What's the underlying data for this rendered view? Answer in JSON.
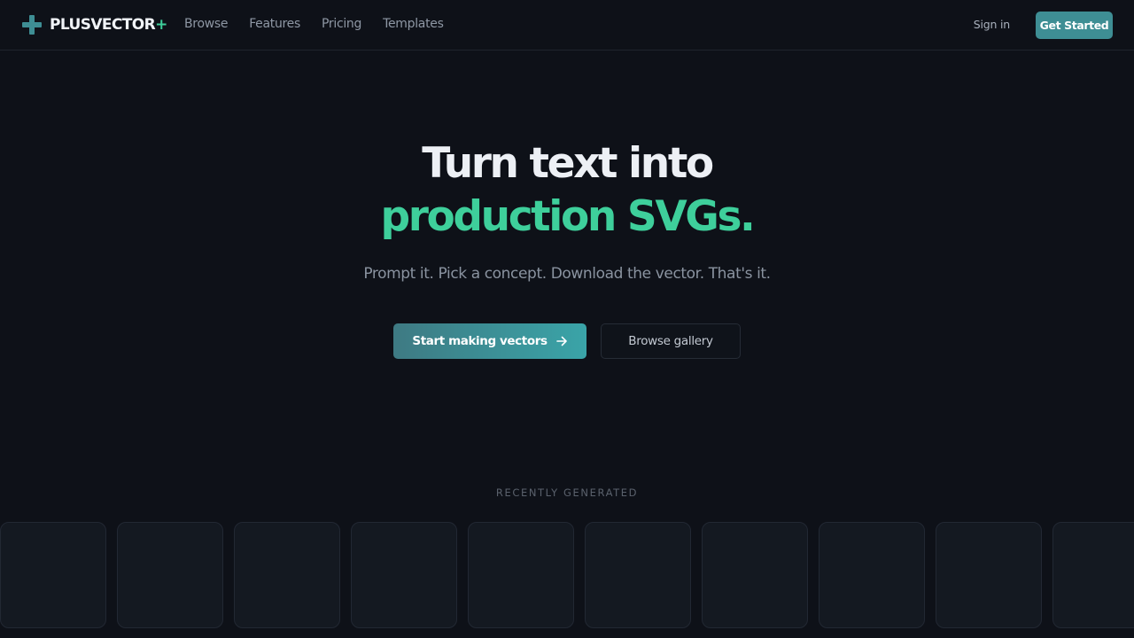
{
  "brand": {
    "name": "PLUSVECTOR",
    "suffix": "+",
    "accent_color": "#3ecf9b",
    "primary_color": "#3e8e94"
  },
  "nav": {
    "items": [
      "Browse",
      "Features",
      "Pricing",
      "Templates"
    ],
    "sign_in": "Sign in",
    "get_started": "Get Started"
  },
  "hero": {
    "line1": "Turn text into",
    "line2": "production SVGs.",
    "subtitle": "Prompt it. Pick a concept. Download the vector. That's it.",
    "primary_cta": "Start making vectors",
    "primary_cta_icon": "arrow-right-icon",
    "secondary_cta": "Browse gallery"
  },
  "recent": {
    "label": "RECENTLY GENERATED",
    "tile_count": 10
  }
}
